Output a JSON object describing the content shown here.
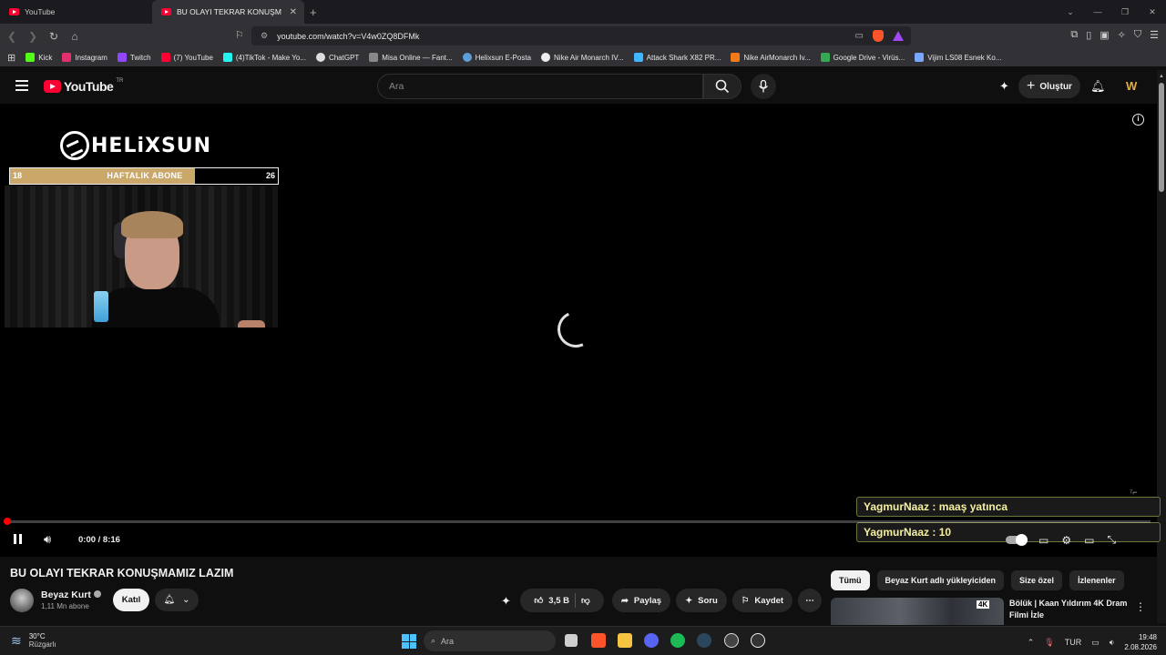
{
  "browser": {
    "tabs": [
      {
        "label": "YouTube",
        "active": false
      },
      {
        "label": "BU OLAYI TEKRAR KONUŞMAMIZ",
        "active": true
      }
    ],
    "url": "youtube.com/watch?v=V4w0ZQ8DFMk",
    "bookmarks": [
      {
        "label": "Kick",
        "color": "#53fc18"
      },
      {
        "label": "Instagram",
        "color": "#e1306c"
      },
      {
        "label": "Twitch",
        "color": "#9146ff"
      },
      {
        "label": "(7) YouTube",
        "color": "#ff0033"
      },
      {
        "label": "(4)TikTok - Make Yo...",
        "color": "#25f4ee"
      },
      {
        "label": "ChatGPT",
        "color": "#dddddd"
      },
      {
        "label": "Misa Online — Fant...",
        "color": "#888888"
      },
      {
        "label": "Helixsun E-Posta",
        "color": "#5f9fd8"
      },
      {
        "label": "Nike Air Monarch IV...",
        "color": "#eeeeee"
      },
      {
        "label": "Attack Shark X82 PR...",
        "color": "#3fb6ff"
      },
      {
        "label": "Nike AirMonarch Iv...",
        "color": "#f27a1a"
      },
      {
        "label": "Google Drive - Virüs...",
        "color": "#34a853"
      },
      {
        "label": "Vijim LS08 Esnek Ko...",
        "color": "#7aa7ff"
      }
    ]
  },
  "youtube": {
    "logo_text": "YouTube",
    "country_code": "TR",
    "search_placeholder": "Ara",
    "create_label": "Oluştur"
  },
  "player": {
    "overlay_brand": "HELiXSUN",
    "sub_goal": {
      "left": "18",
      "title": "HAFTALIK ABONE",
      "right": "26",
      "progress": 0.69
    },
    "chat": [
      {
        "text": "YagmurNaaz : maaş yatınca"
      },
      {
        "text": "YagmurNaaz : 10"
      }
    ],
    "time_current": "0:00",
    "time_total": "8:16",
    "time_display": "0:00 / 8:16",
    "loading": true
  },
  "video": {
    "title": "BU OLAYI TEKRAR KONUŞMAMIZ LAZIM",
    "channel_name": "Beyaz Kurt",
    "channel_subs": "1,11 Mn abone",
    "join_label": "Katıl",
    "likes": "3,5 B",
    "share_label": "Paylaş",
    "ask_label": "Soru",
    "save_label": "Kaydet"
  },
  "sidebar": {
    "chips": [
      {
        "label": "Tümü",
        "active": true
      },
      {
        "label": "Beyaz Kurt adlı yükleyiciden",
        "active": false
      },
      {
        "label": "Size özel",
        "active": false
      },
      {
        "label": "İzlenenler",
        "active": false
      }
    ],
    "rec_title": "Bölük | Kaan Yıldırım 4K Dram Filmi İzle",
    "rec_badge": "4K"
  },
  "taskbar": {
    "temperature": "30°C",
    "weather": "Rüzgarlı",
    "search_label": "Ara",
    "language": "TUR",
    "time": "19:48",
    "date": "2.08.2026"
  }
}
